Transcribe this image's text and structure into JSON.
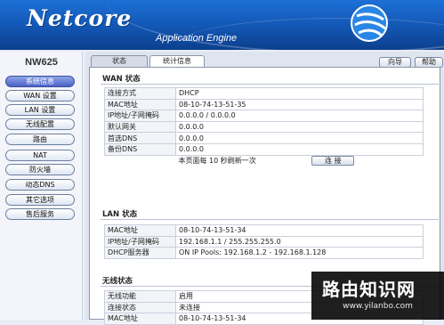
{
  "header": {
    "brand": "Netcore",
    "subtitle": "Application Engine"
  },
  "sidebar": {
    "model": "NW625",
    "items": [
      {
        "label": "系统信息",
        "active": true
      },
      {
        "label": "WAN 设置"
      },
      {
        "label": "LAN 设置"
      },
      {
        "label": "无线配置"
      },
      {
        "label": "路由"
      },
      {
        "label": "NAT"
      },
      {
        "label": "防火墙"
      },
      {
        "label": "动态DNS"
      },
      {
        "label": "其它选项"
      },
      {
        "label": "售后服务"
      }
    ]
  },
  "tabs": [
    {
      "label": "状态"
    },
    {
      "label": "统计信息",
      "active": true
    }
  ],
  "top_buttons": {
    "wizard": "向导",
    "help": "帮助"
  },
  "wan": {
    "title": "WAN 状态",
    "rows": [
      {
        "key": "连接方式",
        "value": "DHCP"
      },
      {
        "key": "MAC地址",
        "value": "08-10-74-13-51-35"
      },
      {
        "key": "IP地址/子网掩码",
        "value": "0.0.0.0 / 0.0.0.0"
      },
      {
        "key": "默认网关",
        "value": "0.0.0.0"
      },
      {
        "key": "首选DNS",
        "value": "0.0.0.0"
      },
      {
        "key": "备份DNS",
        "value": "0.0.0.0"
      }
    ],
    "refresh_text": "本页面每  10 秒刷新一次",
    "connect_button": "连 接"
  },
  "lan": {
    "title": "LAN 状态",
    "rows": [
      {
        "key": "MAC地址",
        "value": "08-10-74-13-51-34"
      },
      {
        "key": "IP地址/子网掩码",
        "value": "192.168.1.1 / 255.255.255.0"
      },
      {
        "key": "DHCP服务器",
        "value": "ON  IP Pools: 192.168.1.2 - 192.168.1.128"
      }
    ]
  },
  "wireless": {
    "title": "无线状态",
    "rows": [
      {
        "key": "无线功能",
        "value": "启用"
      },
      {
        "key": "连接状态",
        "value": "未连接"
      },
      {
        "key": "MAC地址",
        "value": "08-10-74-13-51-34"
      }
    ]
  },
  "watermark": {
    "title": "路由知识网",
    "url": "www.yilanbo.com"
  },
  "colors": {
    "header_blue": "#1356b3",
    "active_nav": "#4c62c6"
  }
}
